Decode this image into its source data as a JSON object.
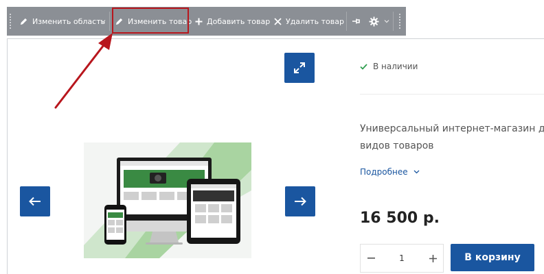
{
  "toolbar": {
    "edit_area": "Изменить область",
    "edit_product": "Изменить товар",
    "add_product": "Добавить товар",
    "delete_product": "Удалить товар"
  },
  "product": {
    "stock": "В наличии",
    "description_line1": "Универсальный интернет-магазин д",
    "description_line2": "видов товаров",
    "more_link": "Подробнее",
    "price": "16 500 р.",
    "quantity": "1",
    "add_to_cart": "В корзину"
  },
  "colors": {
    "toolbar_bg": "#8b8f95",
    "accent_blue": "#1a56a0",
    "highlight_red": "#b8161d",
    "stock_green": "#2e9e4f"
  },
  "icons": {
    "edit_area": "pencil-icon",
    "edit_product": "pencil-icon",
    "add_product": "plus-icon",
    "delete_product": "close-icon",
    "pin": "pin-icon",
    "settings": "gear-icon",
    "fullscreen": "expand-icon",
    "prev": "arrow-left-icon",
    "next": "arrow-right-icon",
    "stock": "checkmark-icon",
    "more": "chevron-down-icon"
  }
}
